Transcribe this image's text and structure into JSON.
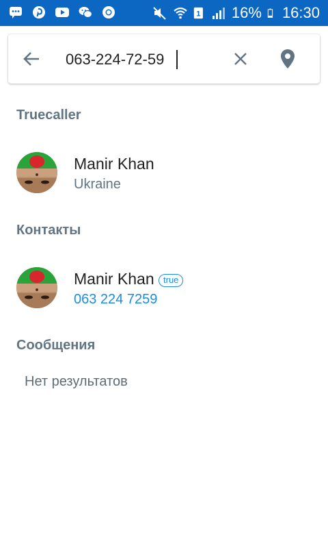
{
  "status_bar": {
    "battery_percent": "16%",
    "time": "16:30",
    "sim_label": "1",
    "left_icons": [
      "messages-icon",
      "pinterest-icon",
      "youtube-icon",
      "wechat-icon",
      "chrome-icon"
    ],
    "right_icons": [
      "mute-icon",
      "wifi-icon",
      "sim-icon",
      "signal-icon",
      "battery-icon"
    ]
  },
  "search": {
    "value": "063-224-72-59"
  },
  "sections": {
    "truecaller": "Truecaller",
    "contacts": "Контакты",
    "messages": "Сообщения"
  },
  "truecaller_result": {
    "name": "Manir Khan",
    "subtitle": "Ukraine"
  },
  "contact_result": {
    "name": "Manir Khan",
    "badge": "true",
    "phone": "063 224 7259"
  },
  "messages_result": {
    "empty_text": "Нет результатов"
  },
  "colors": {
    "status_bar": "#0c67c2",
    "section_header": "#607483",
    "accent": "#1a8ce3"
  }
}
